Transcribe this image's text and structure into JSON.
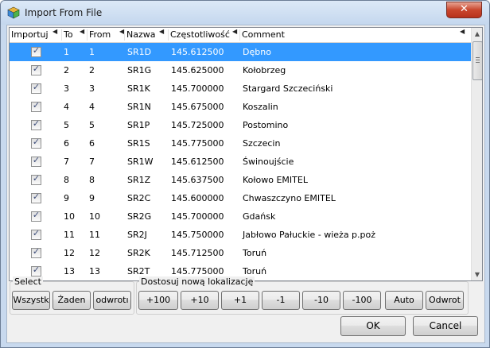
{
  "window": {
    "title": "Import From File",
    "close_glyph": "✕"
  },
  "table": {
    "columns": [
      {
        "label": "Importuj"
      },
      {
        "label": "To"
      },
      {
        "label": "From"
      },
      {
        "label": "Nazwa"
      },
      {
        "label": "Częstotliwość"
      },
      {
        "label": "Comment"
      }
    ],
    "selected_row": 0,
    "rows": [
      {
        "checked": true,
        "to": "1",
        "from": "1",
        "name": "SR1D",
        "freq": "145.612500",
        "comment": "Dębno"
      },
      {
        "checked": true,
        "to": "2",
        "from": "2",
        "name": "SR1G",
        "freq": "145.625000",
        "comment": "Kołobrzeg"
      },
      {
        "checked": true,
        "to": "3",
        "from": "3",
        "name": "SR1K",
        "freq": "145.700000",
        "comment": "Stargard Szczeciński"
      },
      {
        "checked": true,
        "to": "4",
        "from": "4",
        "name": "SR1N",
        "freq": "145.675000",
        "comment": "Koszalin"
      },
      {
        "checked": true,
        "to": "5",
        "from": "5",
        "name": "SR1P",
        "freq": "145.725000",
        "comment": "Postomino"
      },
      {
        "checked": true,
        "to": "6",
        "from": "6",
        "name": "SR1S",
        "freq": "145.775000",
        "comment": "Szczecin"
      },
      {
        "checked": true,
        "to": "7",
        "from": "7",
        "name": "SR1W",
        "freq": "145.612500",
        "comment": "Świnoujście"
      },
      {
        "checked": true,
        "to": "8",
        "from": "8",
        "name": "SR1Z",
        "freq": "145.637500",
        "comment": "Kołowo EMITEL"
      },
      {
        "checked": true,
        "to": "9",
        "from": "9",
        "name": "SR2C",
        "freq": "145.600000",
        "comment": "Chwaszczyno EMITEL"
      },
      {
        "checked": true,
        "to": "10",
        "from": "10",
        "name": "SR2G",
        "freq": "145.700000",
        "comment": "Gdańsk"
      },
      {
        "checked": true,
        "to": "11",
        "from": "11",
        "name": "SR2J",
        "freq": "145.750000",
        "comment": "Jabłowo Pałuckie - wieża p.poż"
      },
      {
        "checked": true,
        "to": "12",
        "from": "12",
        "name": "SR2K",
        "freq": "145.712500",
        "comment": "Toruń"
      },
      {
        "checked": true,
        "to": "13",
        "from": "13",
        "name": "SR2T",
        "freq": "145.775000",
        "comment": "Toruń"
      }
    ]
  },
  "select_group": {
    "label": "Select",
    "buttons": [
      "Wszystk",
      "Żaden",
      "odwrotı"
    ]
  },
  "adjust_group": {
    "label": "Dostosuj nową lokalizację",
    "buttons": [
      "+100",
      "+10",
      "+1",
      "-1",
      "-10",
      "-100",
      "Auto",
      "Odwrot"
    ]
  },
  "footer": {
    "ok_label": "OK",
    "cancel_label": "Cancel"
  },
  "colors": {
    "selection": "#3399ff",
    "close_button": "#c9462d",
    "frame": "#c8d9ee"
  }
}
